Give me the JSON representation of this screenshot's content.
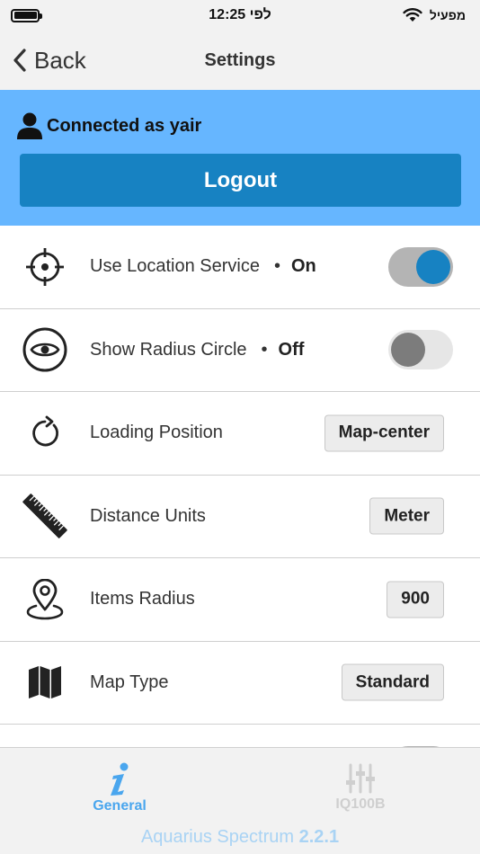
{
  "status_bar": {
    "time": "12:25 לפי",
    "carrier": "מפעיל"
  },
  "nav": {
    "back_label": "Back",
    "title": "Settings"
  },
  "account": {
    "connected_text": "Connected as yair",
    "logout_label": "Logout"
  },
  "settings": {
    "location": {
      "label": "Use Location Service",
      "separator": "•",
      "state": "On",
      "enabled": true
    },
    "radius_circle": {
      "label": "Show Radius Circle",
      "separator": "•",
      "state": "Off",
      "enabled": false
    },
    "loading_position": {
      "label": "Loading Position",
      "value": "Map-center"
    },
    "distance_units": {
      "label": "Distance Units",
      "value": "Meter"
    },
    "items_radius": {
      "label": "Items Radius",
      "value": "900"
    },
    "map_type": {
      "label": "Map Type",
      "value": "Standard"
    }
  },
  "tabs": {
    "general": {
      "label": "General",
      "icon": "info-icon"
    },
    "iq100b": {
      "label": "IQ100B",
      "icon": "sliders-icon"
    }
  },
  "footer": {
    "app_name": "Aquarius Spectrum",
    "version": "2.2.1"
  },
  "colors": {
    "accent": "#1782c2",
    "header_bg": "#66b6ff",
    "tab_active": "#4aa6ee"
  }
}
